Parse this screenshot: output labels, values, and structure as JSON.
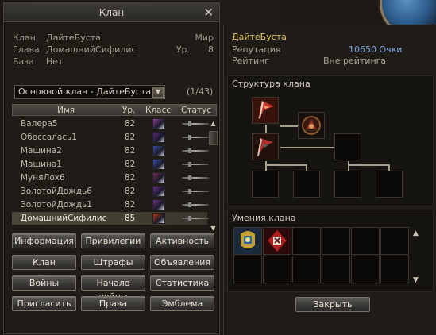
{
  "window": {
    "title": "Клан",
    "close_icon": "×"
  },
  "info": {
    "clan_label": "Клан",
    "clan_value": "ДайтеБуста",
    "leader_label": "Глава",
    "leader_value": "ДомашнийСифилис",
    "base_label": "База",
    "base_value": "Нет",
    "world_label": "Мир",
    "level_label": "Ур.",
    "level_value": "8"
  },
  "subclan_select": {
    "value": "Основной клан - ДайтеБуста"
  },
  "member_count": "(1/43)",
  "table": {
    "headers": {
      "name": "Имя",
      "level": "Ур.",
      "class": "Класс",
      "status": "Статус"
    },
    "rows": [
      {
        "name": "Валера5",
        "level": "82",
        "class_color": "#8a3a9a"
      },
      {
        "name": "Обоссалась1",
        "level": "82",
        "class_color": "#5a2a7a"
      },
      {
        "name": "Машина2",
        "level": "82",
        "class_color": "#3a4fa0"
      },
      {
        "name": "Машина1",
        "level": "82",
        "class_color": "#3a4fa0"
      },
      {
        "name": "МуняЛох6",
        "level": "82",
        "class_color": "#7a2a5a"
      },
      {
        "name": "ЗолотойДождь6",
        "level": "82",
        "class_color": "#6a2a8a"
      },
      {
        "name": "ЗолотойДождь1",
        "level": "82",
        "class_color": "#6a2a8a"
      },
      {
        "name": "ДомашнийСифилис",
        "level": "85",
        "class_color": "#b83a1a",
        "selected": true
      }
    ]
  },
  "buttons": [
    {
      "id": "info",
      "label": "Информация"
    },
    {
      "id": "privileges",
      "label": "Привилегии"
    },
    {
      "id": "activity",
      "label": "Активность"
    },
    {
      "id": "clan",
      "label": "Клан"
    },
    {
      "id": "fines",
      "label": "Штрафы"
    },
    {
      "id": "announcements",
      "label": "Объявления"
    },
    {
      "id": "wars",
      "label": "Войны"
    },
    {
      "id": "start-war",
      "label": "Начало войны"
    },
    {
      "id": "statistics",
      "label": "Статистика"
    },
    {
      "id": "invite",
      "label": "Пригласить"
    },
    {
      "id": "rights",
      "label": "Права"
    },
    {
      "id": "emblem",
      "label": "Эмблема"
    }
  ],
  "right": {
    "clan_name": "ДайтеБуста",
    "reputation_label": "Репутация",
    "reputation_value": "10650 Очки",
    "rating_label": "Рейтинг",
    "rating_value": "Вне рейтинга",
    "structure_title": "Структура клана",
    "skills_title": "Умения клана",
    "close_button": "Закрыть"
  },
  "colors": {
    "clan_name": "#e3c65d",
    "reputation": "#7fa4e0"
  }
}
